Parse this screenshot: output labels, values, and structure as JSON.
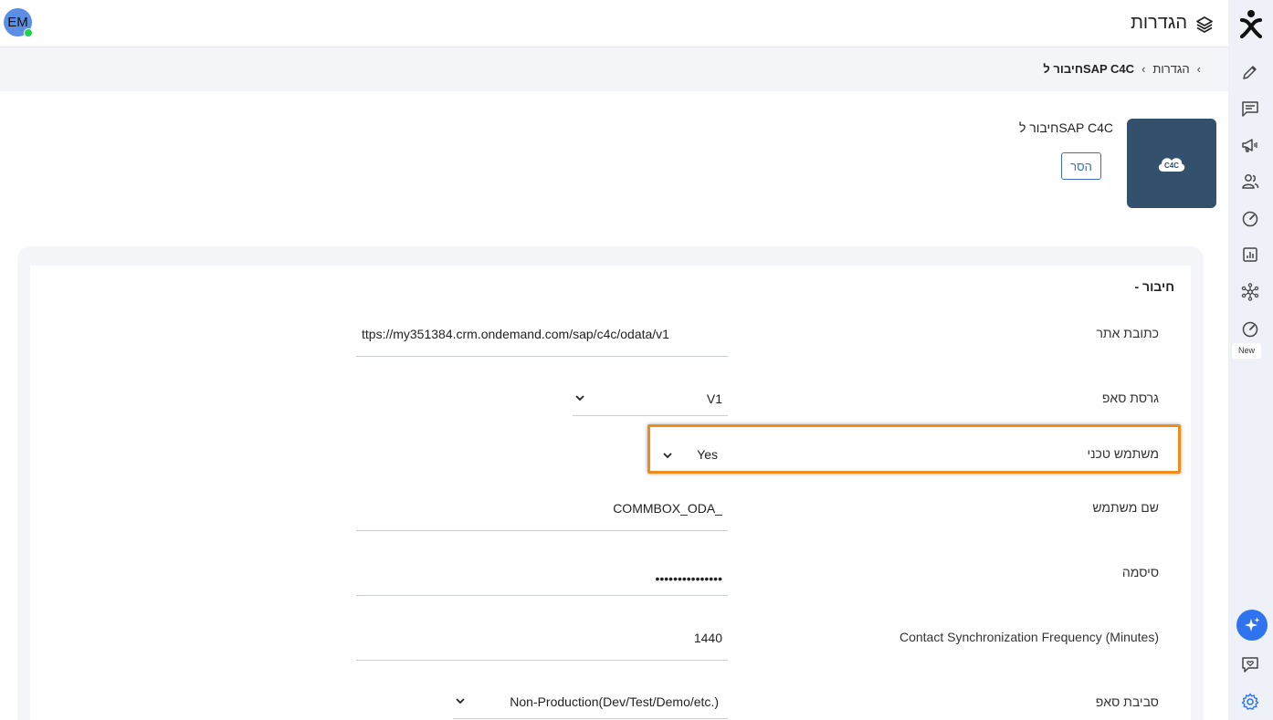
{
  "header": {
    "title": "הגדרות",
    "avatar_initials": "EM"
  },
  "breadcrumb": {
    "items": [
      "הגדרות",
      "חיבור לSAP C4C"
    ]
  },
  "integration": {
    "name": "חיבור לSAP C4C",
    "logo_text": "C4C",
    "remove_label": "הסר",
    "logo_bg": "#33506d"
  },
  "section": {
    "title": "- חיבור"
  },
  "form": {
    "url_label": "כתובת אתר",
    "url_value": "ttps://my351384.crm.ondemand.com/sap/c4c/odata/v1",
    "version_label": "גרסת סאפ",
    "version_value": "V1",
    "technical_user_label": "משתמש טכני",
    "technical_user_value": "Yes",
    "username_label": "שם משתמש",
    "username_value": "COMMBOX_ODA_",
    "password_label": "סיסמה",
    "password_value": "•••••••••••••••",
    "sync_freq_label": "Contact Synchronization Frequency (Minutes)",
    "sync_freq_value": "1440",
    "environment_label": "סביבת סאפ",
    "environment_value": "Non-Production(Dev/Test/Demo/etc.)"
  },
  "rail": {
    "items": [
      "edit-icon",
      "chat-icon",
      "megaphone-icon",
      "users-icon",
      "gauge-icon",
      "reports-icon",
      "network-icon",
      "gauge-new-icon"
    ],
    "new_badge": "New"
  },
  "colors": {
    "accent": "#2f73ef",
    "highlight": "#ef8a1c",
    "rail_bg": "#eef1f8"
  }
}
